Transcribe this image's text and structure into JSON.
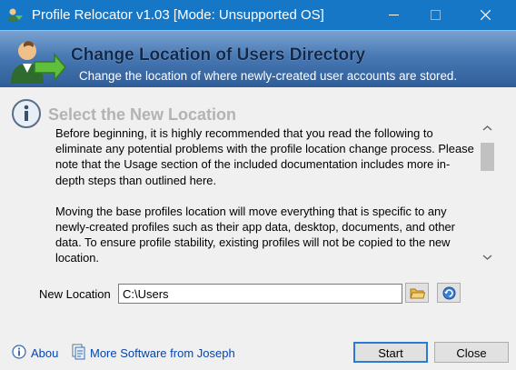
{
  "window": {
    "title": "Profile Relocator v1.03 [Mode: Unsupported OS]",
    "icons": [
      "app-icon",
      "minimize-icon",
      "maximize-icon",
      "close-icon"
    ]
  },
  "banner": {
    "title": "Change Location of Users Directory",
    "subtitle": "Change the location of where newly-created user accounts are stored.",
    "icon": "users-arrow-icon"
  },
  "section": {
    "title": "Select the New Location",
    "icon": "info-icon"
  },
  "info": {
    "paragraphs": [
      "Before beginning, it is highly recommended that you read the following to eliminate any potential problems with the profile location change process. Please note that the Usage section of the included documentation includes more in-depth steps than outlined here.",
      "Moving the base profiles location will move everything that is specific to any newly-created profiles such as their app data, desktop, documents, and other data. To ensure profile stability, existing profiles will not be copied to the new location."
    ]
  },
  "location": {
    "label": "New Location",
    "value": "C:\\Users",
    "browse_icon": "folder-icon",
    "refresh_icon": "refresh-icon"
  },
  "footer": {
    "about_label": "Abou",
    "more_label": "More Software from Joseph",
    "start_label": "Start",
    "close_label": "Close"
  },
  "colors": {
    "titlebar": "#1777c7",
    "banner": "#4879b4",
    "link": "#0645ad",
    "default_button_border": "#2a7ad6"
  }
}
